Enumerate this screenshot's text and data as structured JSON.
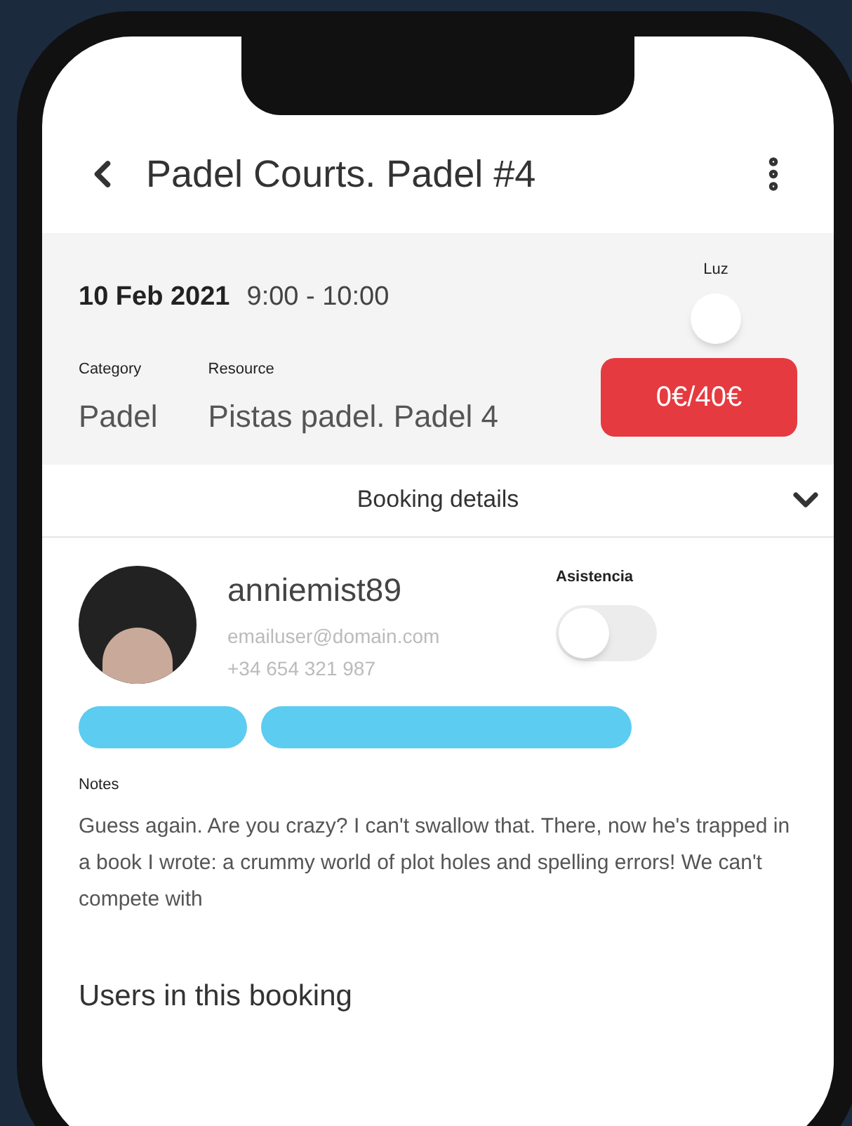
{
  "header": {
    "title": "Padel Courts. Padel #4"
  },
  "booking": {
    "date": "10 Feb 2021",
    "time": "9:00 - 10:00",
    "light": {
      "label": "Luz",
      "on": false
    },
    "category": {
      "label": "Category",
      "value": "Padel"
    },
    "resource": {
      "label": "Resource",
      "value": "Pistas padel. Padel 4"
    },
    "price": "0€/40€"
  },
  "details": {
    "label": "Booking details",
    "expanded": false
  },
  "user": {
    "name": "anniemist89",
    "email": "emailuser@domain.com",
    "phone": "+34 654 321 987",
    "attendance": {
      "label": "Asistencia",
      "on": false
    },
    "tags": [
      {
        "kind": "short"
      },
      {
        "kind": "long"
      }
    ]
  },
  "notes": {
    "label": "Notes",
    "text": "Guess again. Are you crazy? I can't swallow that. There, now he's trapped in a book I wrote: a crummy world of plot holes and spelling errors! We can't compete with"
  },
  "users_section": {
    "title": "Users in this booking"
  }
}
